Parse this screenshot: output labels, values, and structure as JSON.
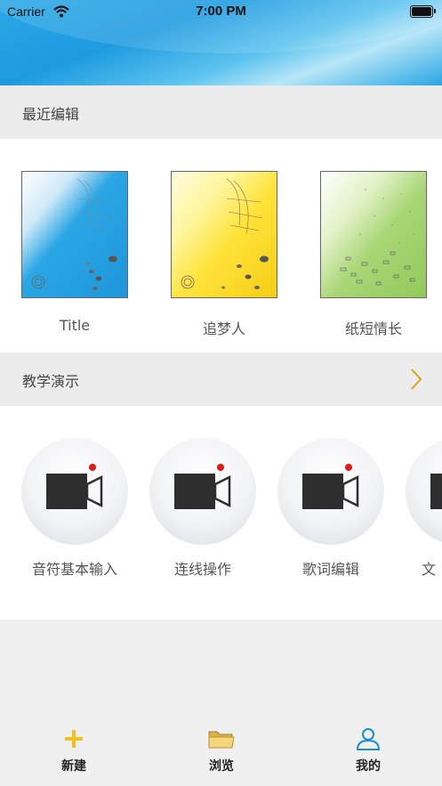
{
  "status_bar": {
    "carrier": "Carrier",
    "time": "7:00 PM"
  },
  "recent": {
    "title": "最近编辑",
    "items": [
      {
        "label": "Title",
        "theme": "blue"
      },
      {
        "label": "追梦人",
        "theme": "yellow"
      },
      {
        "label": "纸短情长",
        "theme": "green"
      }
    ]
  },
  "demos": {
    "title": "教学演示",
    "items": [
      {
        "label": "音符基本输入"
      },
      {
        "label": "连线操作"
      },
      {
        "label": "歌词编辑"
      },
      {
        "label": "文"
      }
    ]
  },
  "tabbar": {
    "items": [
      {
        "label": "新建",
        "icon": "plus-icon"
      },
      {
        "label": "浏览",
        "icon": "folder-icon"
      },
      {
        "label": "我的",
        "icon": "person-icon"
      }
    ]
  },
  "colors": {
    "accent": "#2aa8e6",
    "tab_active": "#1a8fd6",
    "plus": "#f0c020",
    "chevron": "#d8a21a"
  }
}
